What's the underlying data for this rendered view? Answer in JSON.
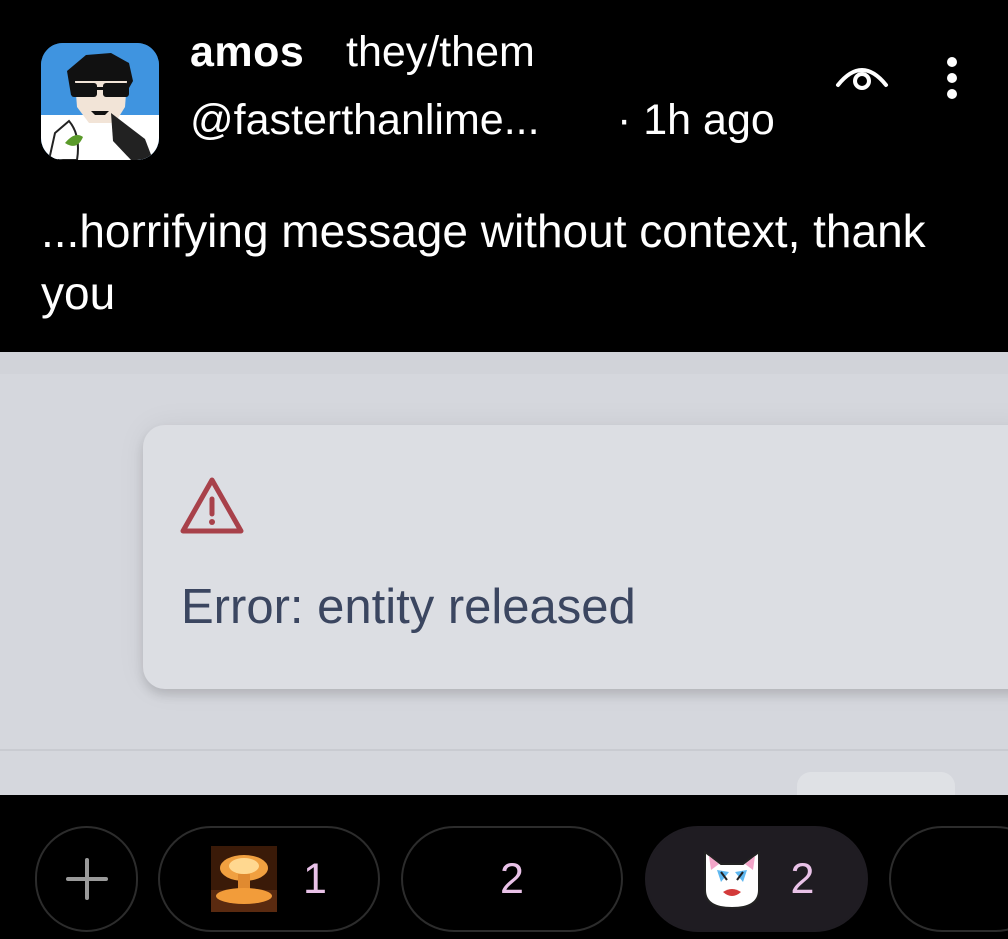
{
  "author": {
    "name": "amos",
    "pronouns": "they/them",
    "handle": "@fasterthanlime...",
    "time": "· 1h ago"
  },
  "post": {
    "text": "...horrifying message without context, thank you"
  },
  "attachment": {
    "error_text": "Error: entity released",
    "icon": "warning-triangle-icon",
    "icon_color": "#a8414a"
  },
  "icons": {
    "visibility": "eye-icon",
    "more": "more-vertical-icon"
  },
  "reactions": {
    "add_label": "+",
    "items": [
      {
        "emoji": "explosion",
        "count": "1"
      },
      {
        "emoji": "",
        "count": "2"
      },
      {
        "emoji": "crying-cat",
        "count": "2",
        "selected": true
      }
    ]
  },
  "colors": {
    "background": "#000000",
    "text": "#ffffff",
    "reaction_count": "#e9c2e8",
    "error_text": "#3b4660"
  }
}
